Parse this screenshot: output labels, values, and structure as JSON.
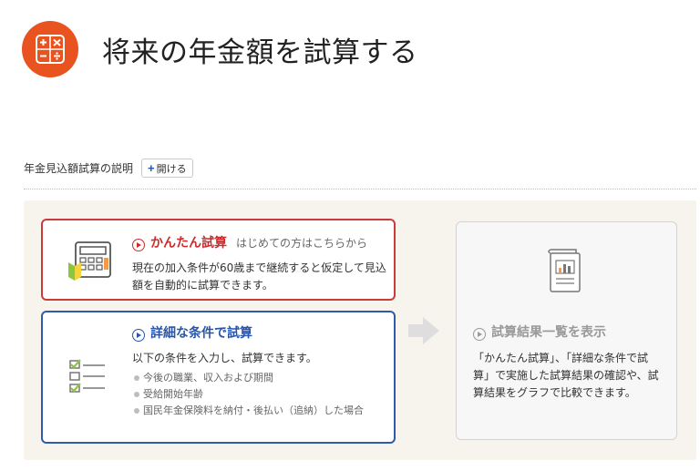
{
  "header": {
    "icon": "calculator-badge-icon",
    "title": "将来の年金額を試算する"
  },
  "explanation": {
    "label": "年金見込額試算の説明",
    "open_button": "開ける"
  },
  "cards": {
    "easy": {
      "title": "かんたん試算",
      "subtitle": "はじめての方はこちらから",
      "description": "現在の加入条件が60歳まで継続すると仮定して見込額を自動的に試算できます。",
      "icon": "calculator-beginner-icon"
    },
    "detail": {
      "title": "詳細な条件で試算",
      "description": "以下の条件を入力し、試算できます。",
      "items": [
        "今後の職業、収入および期間",
        "受給開始年齢",
        "国民年金保険料を納付・後払い（追納）した場合"
      ],
      "icon": "checklist-icon"
    },
    "result": {
      "title": "試算結果一覧を表示",
      "description": "「かんたん試算」、「詳細な条件で試算」で実施した試算結果の確認や、試算結果をグラフで比較できます。",
      "icon": "report-chart-icon"
    }
  },
  "colors": {
    "accent_orange": "#e8531f",
    "easy_red": "#cc3a3a",
    "detail_blue": "#2e5ca8",
    "panel_bg": "#f7f4ee"
  }
}
